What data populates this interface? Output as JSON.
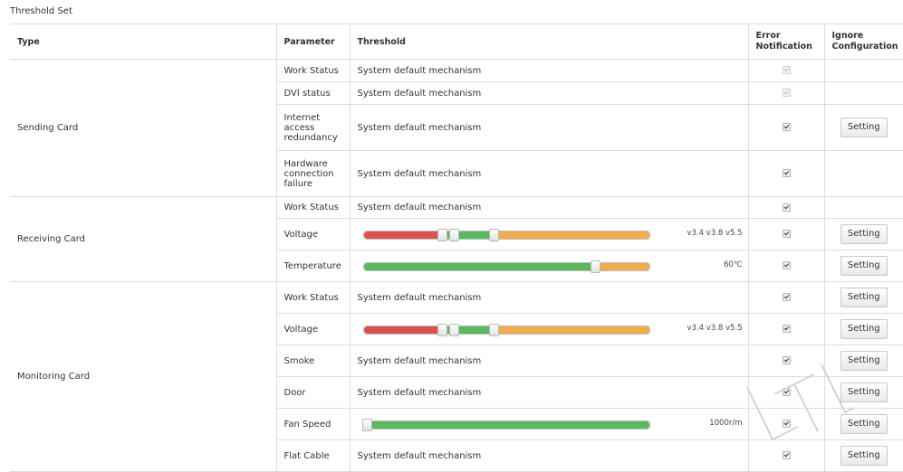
{
  "page": {
    "title": "Threshold Set"
  },
  "headers": {
    "type": "Type",
    "parameter": "Parameter",
    "threshold": "Threshold",
    "error_notification": "Error Notification",
    "ignore_configuration": "Ignore Configuration"
  },
  "groups": [
    {
      "type": "Sending Card",
      "rows": [
        {
          "parameter": "Work Status",
          "threshold": "System default mechanism",
          "error_checked": true,
          "error_disabled": true,
          "setting": ""
        },
        {
          "parameter": "DVI status",
          "threshold": "System default mechanism",
          "error_checked": true,
          "error_disabled": true,
          "setting": ""
        },
        {
          "parameter": "Internet access redundancy",
          "threshold": "System default mechanism",
          "error_checked": true,
          "error_disabled": false,
          "setting": "Setting"
        },
        {
          "parameter": "Hardware connection failure",
          "threshold": "System default mechanism",
          "error_checked": true,
          "error_disabled": false,
          "setting": ""
        }
      ]
    },
    {
      "type": "Receiving Card",
      "rows": [
        {
          "parameter": "Work Status",
          "threshold": "System default mechanism",
          "error_checked": true,
          "error_disabled": false,
          "setting": ""
        },
        {
          "parameter": "Voltage",
          "slider": {
            "kind": "voltage",
            "handles_pct": [
              27.5,
              31.5,
              45.5
            ]
          },
          "value": "v3.4 v3.8 v5.5",
          "error_checked": true,
          "error_disabled": false,
          "setting": "Setting"
        },
        {
          "parameter": "Temperature",
          "slider": {
            "kind": "temperature",
            "handles_pct": [
              81
            ]
          },
          "value": "60℃",
          "error_checked": true,
          "error_disabled": false,
          "setting": "Setting"
        }
      ]
    },
    {
      "type": "Monitoring Card",
      "rows": [
        {
          "parameter": "Work Status",
          "threshold": "System default mechanism",
          "error_checked": true,
          "error_disabled": false,
          "setting": "Setting"
        },
        {
          "parameter": "Voltage",
          "slider": {
            "kind": "voltage",
            "handles_pct": [
              27.5,
              31.5,
              45.5
            ]
          },
          "value": "v3.4 v3.8 v5.5",
          "error_checked": true,
          "error_disabled": false,
          "setting": "Setting"
        },
        {
          "parameter": "Smoke",
          "threshold": "System default mechanism",
          "error_checked": true,
          "error_disabled": false,
          "setting": "Setting"
        },
        {
          "parameter": "Door",
          "threshold": "System default mechanism",
          "error_checked": true,
          "error_disabled": false,
          "setting": "Setting"
        },
        {
          "parameter": "Fan Speed",
          "slider": {
            "kind": "fan",
            "handles_pct": [
              1
            ]
          },
          "value": "1000r/m",
          "error_checked": true,
          "error_disabled": false,
          "setting": "Setting"
        },
        {
          "parameter": "Flat Cable",
          "threshold": "System default mechanism",
          "error_checked": true,
          "error_disabled": false,
          "setting": "Setting"
        }
      ]
    }
  ],
  "watermark": {
    "text": "LTL"
  },
  "colors": {
    "red": "#d9534f",
    "green": "#5cb85c",
    "orange": "#f0ad4e",
    "border": "#dcdcdc"
  }
}
